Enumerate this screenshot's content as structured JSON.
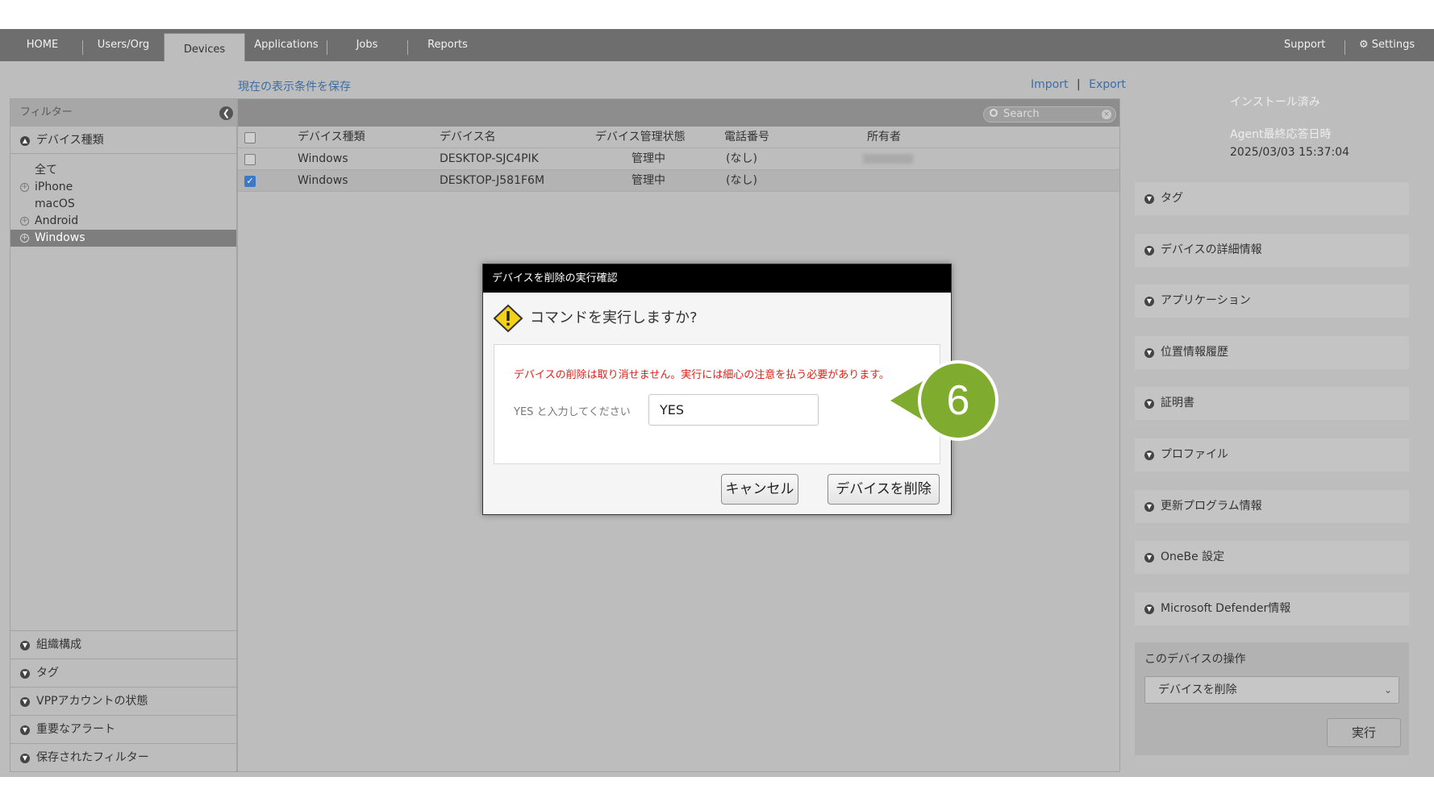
{
  "nav": {
    "tabs": [
      "HOME",
      "Users/Org",
      "Devices",
      "Applications",
      "Jobs",
      "Reports"
    ],
    "active": "Devices",
    "support": "Support",
    "settings": "Settings"
  },
  "links": {
    "save_filter": "現在の表示条件を保存",
    "import": "Import",
    "separator": "|",
    "export": "Export"
  },
  "sidebar": {
    "header": "フィルター",
    "device_type": "デバイス種類",
    "devices": [
      "全て",
      "iPhone",
      "macOS",
      "Android",
      "Windows"
    ],
    "selected": "Windows",
    "sections": [
      "組織構成",
      "タグ",
      "VPPアカウントの状態",
      "重要なアラート",
      "保存されたフィルター"
    ]
  },
  "table": {
    "search_placeholder": "Search",
    "headers": [
      "デバイス種類",
      "デバイス名",
      "デバイス管理状態",
      "電話番号",
      "所有者"
    ],
    "rows": [
      {
        "type": "Windows",
        "name": "DESKTOP-SJC4PIK",
        "status": "管理中",
        "phone": "(なし)",
        "checked": false
      },
      {
        "type": "Windows",
        "name": "DESKTOP-J581F6M",
        "status": "管理中",
        "phone": "(なし)",
        "checked": true
      }
    ]
  },
  "right_panel": {
    "installed": "インストール済み",
    "agent_label": "Agent最終応答日時",
    "agent_time": "2025/03/03 15:37:04",
    "sections": [
      "タグ",
      "デバイスの詳細情報",
      "アプリケーション",
      "位置情報履歴",
      "証明書",
      "プロファイル",
      "更新プログラム情報",
      "OneBe 設定",
      "Microsoft Defender情報"
    ],
    "action_title": "このデバイスの操作",
    "action_value": "デバイスを削除",
    "execute": "実行"
  },
  "modal": {
    "title": "デバイスを削除の実行確認",
    "question": "コマンドを実行しますか?",
    "warning": "デバイスの削除は取り消せません。実行には細心の注意を払う必要があります。",
    "input_label": "YES と入力してください",
    "input_value": "YES",
    "cancel": "キャンセル",
    "confirm": "デバイスを削除"
  },
  "callout": "6",
  "colors": {
    "nav_bg": "#6e6e6e",
    "overlay_bg": "#bdbdbd",
    "link": "#3a6ea5",
    "warning_text": "#e0201a",
    "callout": "#7fac2e"
  }
}
